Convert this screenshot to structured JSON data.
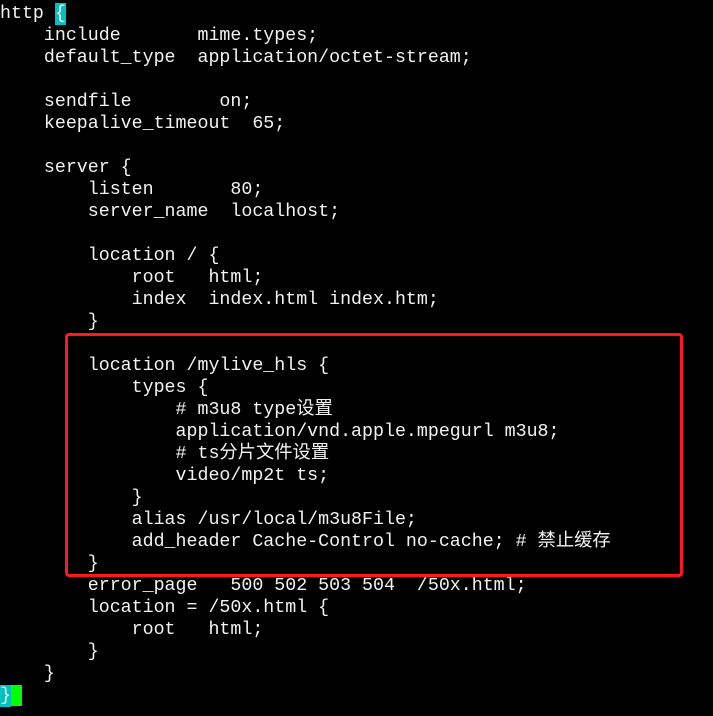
{
  "terminal": {
    "first_line_prefix": "http ",
    "first_line_brace": "{",
    "lines": [
      "",
      "    include       mime.types;",
      "    default_type  application/octet-stream;",
      "",
      "    sendfile        on;",
      "    keepalive_timeout  65;",
      "",
      "    server {",
      "        listen       80;",
      "        server_name  localhost;",
      "",
      "        location / {",
      "            root   html;",
      "            index  index.html index.htm;",
      "        }",
      "",
      "        location /mylive_hls {",
      "            types {",
      "                # m3u8 type设置",
      "                application/vnd.apple.mpegurl m3u8;",
      "                # ts分片文件设置",
      "                video/mp2t ts;",
      "            }",
      "            alias /usr/local/m3u8File;",
      "            add_header Cache-Control no-cache; # 禁止缓存",
      "        }",
      "        error_page   500 502 503 504  /50x.html;",
      "        location = /50x.html {",
      "            root   html;",
      "        }",
      "    }"
    ],
    "last_line_brace": "}",
    "highlight_color": "#ff1a1a",
    "cursor_color": "#00ff00",
    "match_brace_color": "#00c0c0"
  }
}
